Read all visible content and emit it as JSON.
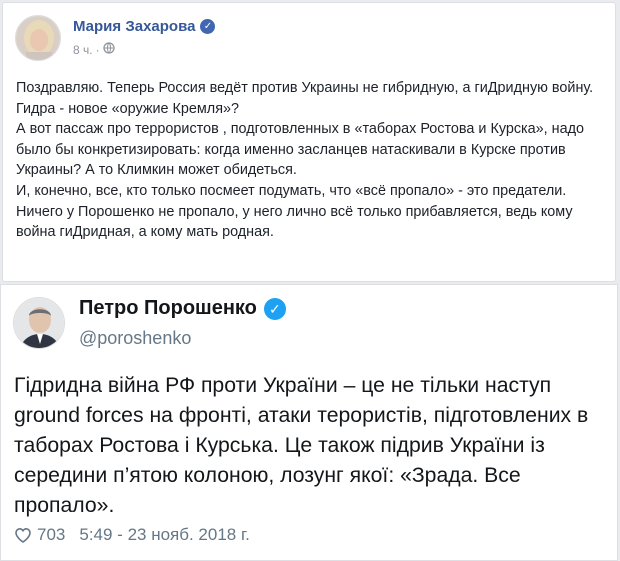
{
  "facebook_post": {
    "author": "Мария Захарова",
    "time": "8 ч.",
    "privacy_separator": "·",
    "privacy_icon": "globe-icon",
    "paragraphs": [
      "Поздравляю. Теперь Россия ведёт против Украины не гибридную, а гиДридную войну. Гидра - новое «оружие Кремля»?",
      "А вот пассаж про террористов , подготовленных в «таборах Ростова и Курска», надо было бы конкретизировать: когда именно засланцев натаскивали в Курске против Украины? А то Климкин может обидеться.",
      "И, конечно, все, кто только посмеет подумать, что «всё пропало» - это предатели. Ничего у Порошенко не пропало, у него лично всё только прибавляется, ведь кому война гиДридная, а кому мать родная."
    ]
  },
  "tweet": {
    "author": "Петро Порошенко",
    "handle": "@poroshenko",
    "lines": [
      "Гідридна війна РФ проти України – це не тільки наступ",
      "ground forces на фронті, атаки терористів, підготовлених в",
      "таборах Ростова і Курська. Це також підрив України із",
      "середини п’ятою колоною, лозунг якої: «Зрада. Все",
      "пропало»."
    ],
    "likes": "703",
    "timestamp": "5:49 - 23 нояб. 2018 г."
  },
  "colors": {
    "facebook_blue": "#365899",
    "twitter_blue": "#1da1f2",
    "background": "#e9ebee"
  }
}
